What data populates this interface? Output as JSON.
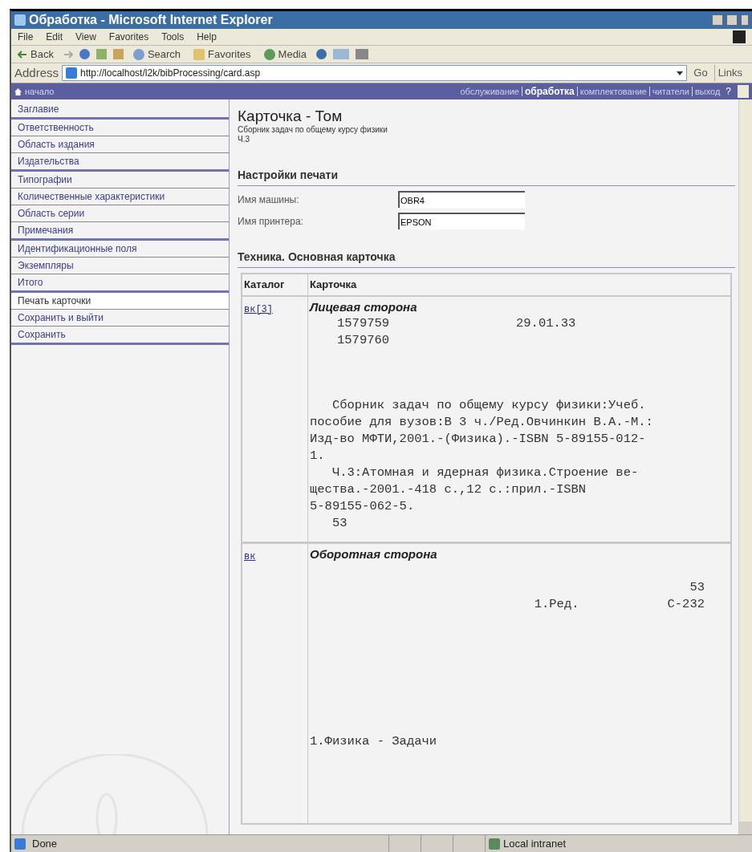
{
  "window": {
    "title": "Обработка - Microsoft Internet Explorer"
  },
  "menu": [
    "File",
    "Edit",
    "View",
    "Favorites",
    "Tools",
    "Help"
  ],
  "toolbar": {
    "back": "Back",
    "search": "Search",
    "favorites": "Favorites",
    "media": "Media"
  },
  "address": {
    "label": "Address",
    "url": "http://localhost/l2k/bibProcessing/card.asp",
    "go": "Go",
    "links": "Links"
  },
  "nav": {
    "home": "начало",
    "links": [
      {
        "label": "обслуживание",
        "selected": false
      },
      {
        "label": "обработка",
        "selected": true
      },
      {
        "label": "комплектование",
        "selected": false
      },
      {
        "label": "читатели",
        "selected": false
      },
      {
        "label": "выход",
        "selected": false
      }
    ],
    "help": "?"
  },
  "sidebar": {
    "groups": [
      {
        "items": [
          {
            "label": "Заглавие",
            "selected": false
          }
        ]
      },
      {
        "items": [
          {
            "label": "Ответственность",
            "selected": false
          },
          {
            "label": "Область издания",
            "selected": false
          },
          {
            "label": "Издательства",
            "selected": false
          }
        ]
      },
      {
        "items": [
          {
            "label": "Типографии",
            "selected": false
          },
          {
            "label": "Количественные характеристики",
            "selected": false
          },
          {
            "label": "Область серии",
            "selected": false
          },
          {
            "label": "Примечания",
            "selected": false
          }
        ]
      },
      {
        "items": [
          {
            "label": "Идентификационные поля",
            "selected": false
          },
          {
            "label": "Экземпляры",
            "selected": false
          },
          {
            "label": "Итого",
            "selected": false
          }
        ]
      },
      {
        "items": [
          {
            "label": "Печать карточки",
            "selected": true
          },
          {
            "label": "Сохранить и выйти",
            "selected": false
          },
          {
            "label": "Сохранить",
            "selected": false
          }
        ]
      }
    ]
  },
  "page": {
    "title": "Карточка - Том",
    "subtitle": "Сборник задач по общему курсу физики",
    "volume": "Ч.3"
  },
  "print_settings": {
    "heading": "Настройки печати",
    "fields": [
      {
        "label": "Имя машины:",
        "value": "OBR4"
      },
      {
        "label": "Имя принтера:",
        "value": "EPSON"
      }
    ]
  },
  "card": {
    "heading": "Техника. Основная карточка",
    "columns": [
      "Каталог",
      "Карточка"
    ],
    "rows": [
      {
        "kind": "front",
        "catalog": "вк[3]",
        "side": "Лицевая сторона",
        "numbers": [
          [
            "1579759",
            "29.01.33"
          ],
          [
            "1579760"
          ]
        ],
        "lines": [
          "   Сборник задач по общему курсу физики:Учеб.",
          "пособие для вузов:В 3 ч./Ред.Овчинкин В.А.-М.:",
          "Изд-во МФТИ,2001.-(Физика).-ISBN 5-89155-012-",
          "1.",
          "   Ч.3:Атомная и ядерная физика.Строение ве-",
          "щества.-2001.-418 с.,12 с.:прил.-ISBN",
          "5-89155-062-5.",
          "   53"
        ]
      },
      {
        "kind": "back",
        "catalog": "вк",
        "side": "Оборотная сторона",
        "code": "53",
        "editor": "1.Ред.",
        "cipher": "С-232",
        "subject": "1.Физика - Задачи"
      }
    ]
  },
  "status_bar": {
    "text": "Done",
    "zone": "Local intranet"
  }
}
